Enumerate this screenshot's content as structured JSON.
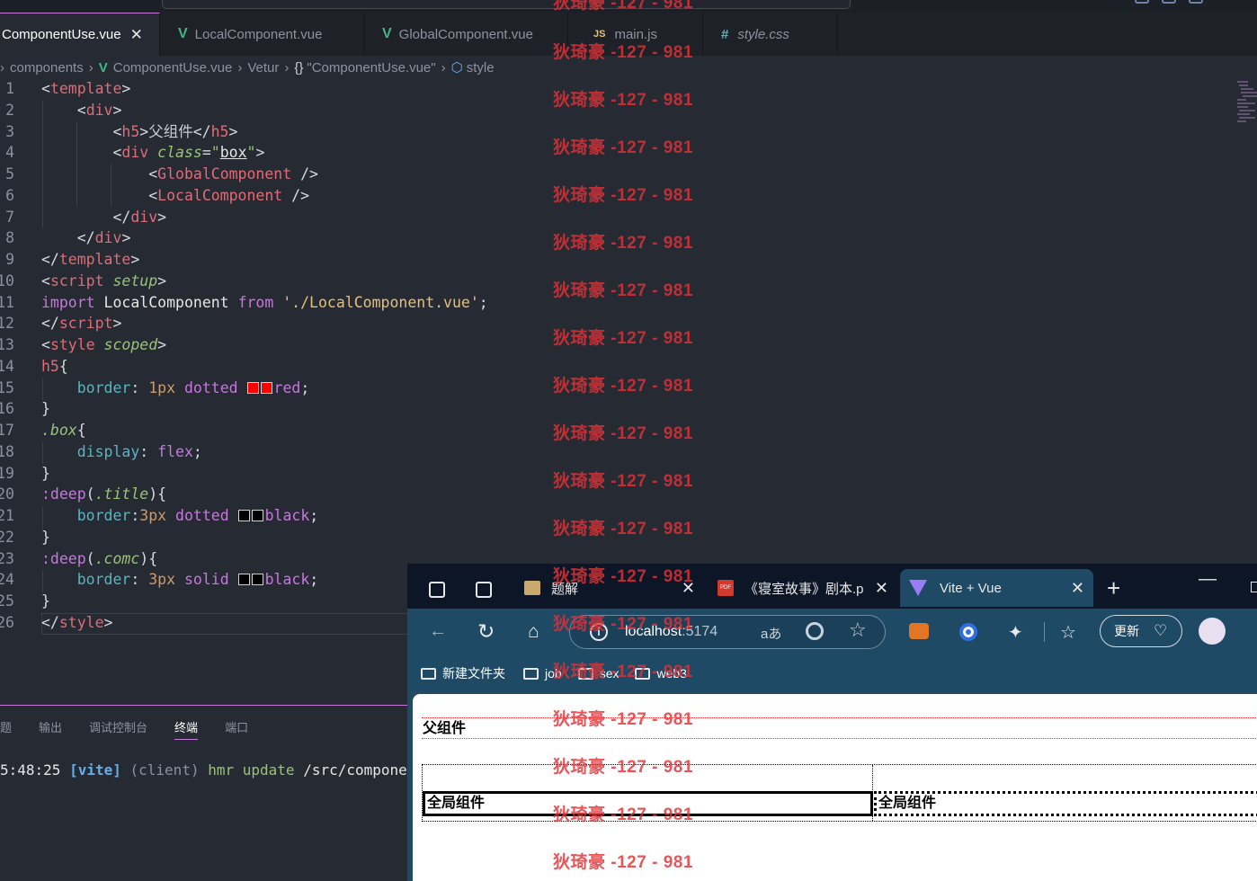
{
  "tabs": [
    {
      "label": "ComponentUse.vue",
      "icon": "vue",
      "active": true
    },
    {
      "label": "LocalComponent.vue",
      "icon": "vue"
    },
    {
      "label": "GlobalComponent.vue",
      "icon": "vue"
    },
    {
      "label": "main.js",
      "icon": "js"
    },
    {
      "label": "style.css",
      "icon": "css"
    }
  ],
  "breadcrumb": {
    "folder": "components",
    "file": "ComponentUse.vue",
    "lang": "Vetur",
    "scope": "\"ComponentUse.vue\"",
    "symbol": "style"
  },
  "code": {
    "line_numbers": [
      "1",
      "2",
      "3",
      "4",
      "5",
      "6",
      "7",
      "8",
      "9",
      "10",
      "11",
      "12",
      "13",
      "14",
      "15",
      "16",
      "17",
      "18",
      "19",
      "20",
      "21",
      "22",
      "23",
      "24",
      "25",
      "26"
    ],
    "l3_text": "父组件",
    "l4_class_value": "box",
    "l11_import": "import",
    "l11_name": "LocalComponent",
    "l11_from": "from",
    "l11_path": "'./LocalComponent.vue'"
  },
  "panel": {
    "tabs": [
      "题",
      "输出",
      "调试控制台",
      "终端",
      "端口"
    ],
    "active_tab": "终端",
    "term_time": "5:48:25",
    "term_vite": "[vite]",
    "term_client": "(client)",
    "term_hmr": "hmr update",
    "term_path": "/src/components/"
  },
  "browser": {
    "tabs": [
      {
        "label": "题解"
      },
      {
        "label": "《寝室故事》剧本.pd"
      },
      {
        "label": "Vite + Vue",
        "active": true
      }
    ],
    "url_host": "localhost",
    "url_port": ":5174",
    "read_aloud": "aあ",
    "update_label": "更新",
    "bookmarks": [
      "新建文件夹",
      "job",
      "sex",
      "web3"
    ],
    "page": {
      "h5": "父组件",
      "global_title_1": "全局组件",
      "global_title_2": "全局组件"
    }
  },
  "watermark": "狄琦豪 -127 - 981",
  "colors": {
    "accent": "#c678dd",
    "vue_green": "#42b883",
    "watermark": "#e13237"
  }
}
